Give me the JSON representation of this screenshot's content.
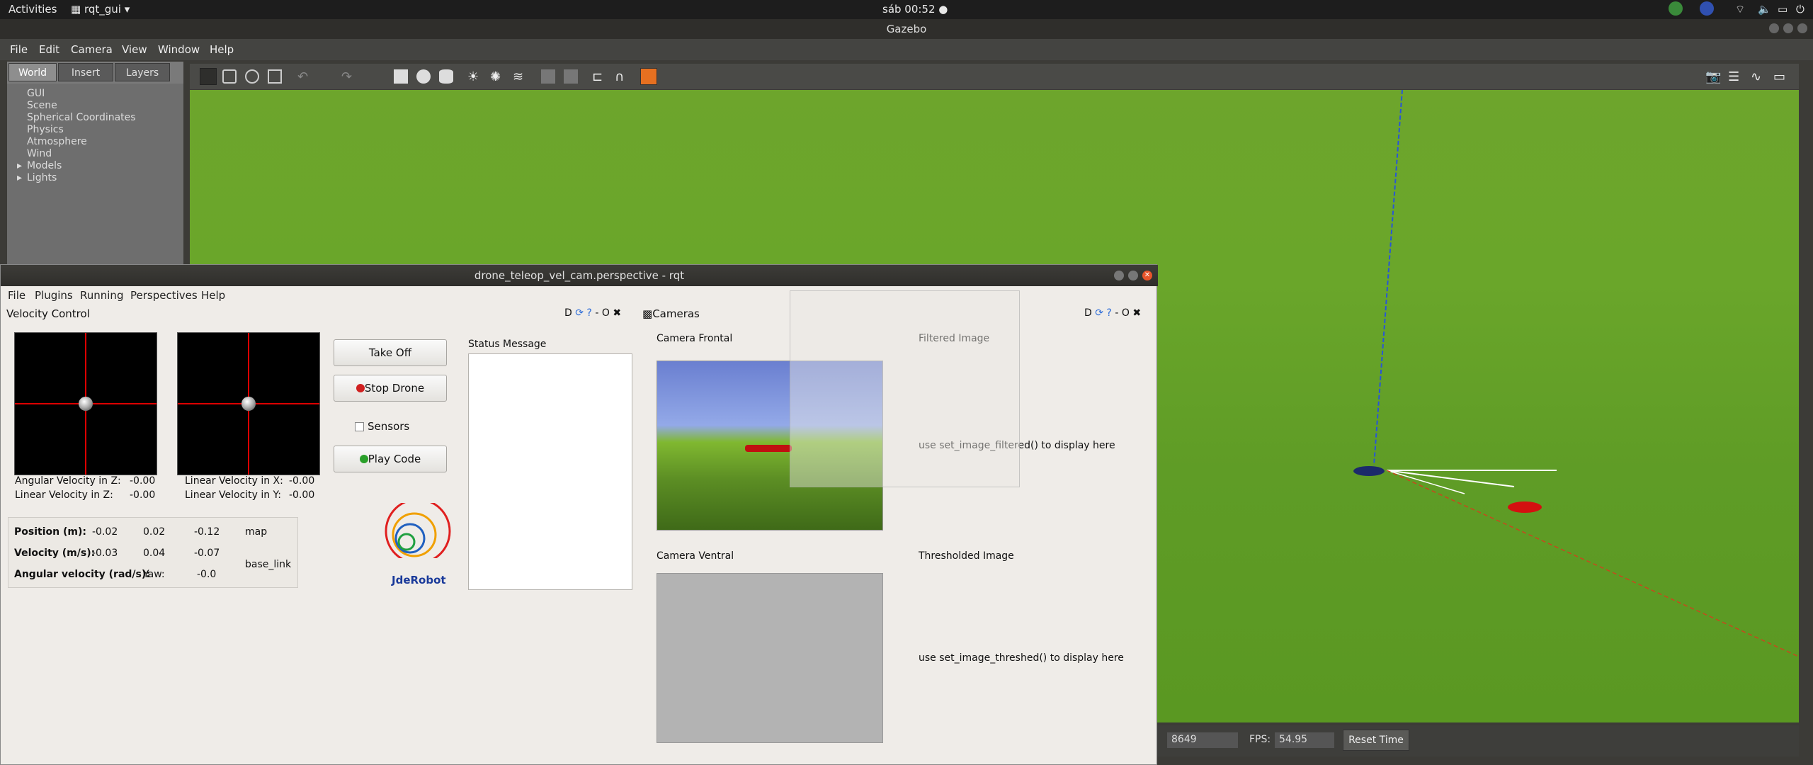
{
  "topbar": {
    "activities": "Activities",
    "app_menu": "rqt_gui",
    "clock": "sáb 00:52 ●"
  },
  "gazebo": {
    "window_title": "Gazebo",
    "menu": [
      "File",
      "Edit",
      "Camera",
      "View",
      "Window",
      "Help"
    ],
    "tabs": [
      "World",
      "Insert",
      "Layers"
    ],
    "tree": [
      "GUI",
      "Scene",
      "Spherical Coordinates",
      "Physics",
      "Atmosphere",
      "Wind",
      "Models",
      "Lights"
    ],
    "bottom": {
      "iterations_value": "8649",
      "fps_label": "FPS:",
      "fps_value": "54.95",
      "reset_time": "Reset Time"
    }
  },
  "rqt": {
    "window_title": "drone_teleop_vel_cam.perspective - rqt",
    "menu": [
      "File",
      "Plugins",
      "Running",
      "Perspectives",
      "Help"
    ],
    "velocity_control_title": "Velocity Control",
    "cameras_title": "Cameras",
    "plugin_controls": "D",
    "angular_velocity_z_label": "Angular Velocity in Z:",
    "angular_velocity_z_value": "-0.00",
    "linear_velocity_z_label": "Linear Velocity in Z:",
    "linear_velocity_z_value": "-0.00",
    "linear_velocity_x_label": "Linear Velocity in X:",
    "linear_velocity_x_value": "-0.00",
    "linear_velocity_y_label": "Linear Velocity in Y:",
    "linear_velocity_y_value": "-0.00",
    "buttons": {
      "take_off": "Take Off",
      "stop_drone": "Stop Drone",
      "sensors": "Sensors",
      "play_code": "Play Code"
    },
    "status_message_label": "Status Message",
    "logo_text": "JdeRobot",
    "telemetry": {
      "position_label": "Position (m):",
      "position": [
        "-0.02",
        "0.02",
        "-0.12"
      ],
      "frame_map": "map",
      "velocity_label": "Velocity (m/s):",
      "velocity": [
        "-0.03",
        "0.04",
        "-0.07"
      ],
      "frame_base": "base_link",
      "angular_label": "Angular velocity (rad/s):",
      "yaw_label": "Yaw:",
      "yaw_value": "-0.0"
    },
    "camera_frontal_label": "Camera Frontal",
    "filtered_image_label": "Filtered Image",
    "filtered_hint": "use set_image_filtered() to display here",
    "camera_ventral_label": "Camera Ventral",
    "thresholded_image_label": "Thresholded Image",
    "threshed_hint": "use set_image_threshed() to display here"
  }
}
